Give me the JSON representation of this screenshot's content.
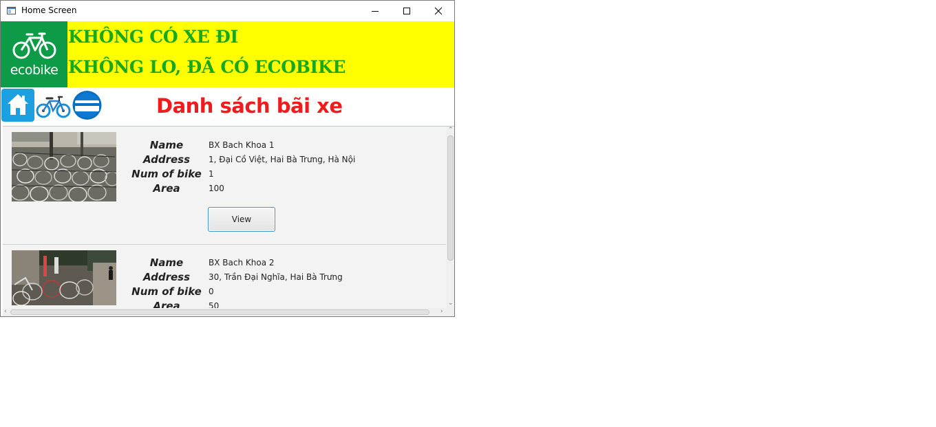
{
  "window": {
    "title": "Home Screen",
    "controls": {
      "minimize_icon": "minimize-icon",
      "maximize_icon": "maximize-icon",
      "close_icon": "close-icon"
    }
  },
  "banner": {
    "logo_text": "ecobike",
    "slogan_line1": "KHÔNG CÓ XE ĐI",
    "slogan_line2": "KHÔNG LO, ĐÃ CÓ ECOBIKE",
    "colors": {
      "background": "#ffff00",
      "slogan": "#18a818",
      "logo_bg": "#0d9b48"
    }
  },
  "nav": {
    "home_icon": "home-icon",
    "bike_icon": "bicycle-icon",
    "card_icon": "card-icon",
    "page_title": "Danh sách bãi xe",
    "title_color": "#ee1c1c"
  },
  "labels": {
    "name": "Name",
    "address": "Address",
    "num_bikes": "Num of bike",
    "area": "Area"
  },
  "stations": [
    {
      "name": "BX Bach Khoa 1",
      "address": "1, Đại Cồ Việt, Hai Bà Trưng, Hà Nội",
      "num_bikes": "1",
      "area": "100",
      "view_label": "View"
    },
    {
      "name": "BX Bach Khoa 2",
      "address": "30, Trần Đại Nghĩa, Hai Bà Trưng",
      "num_bikes": "0",
      "area": "50"
    }
  ]
}
